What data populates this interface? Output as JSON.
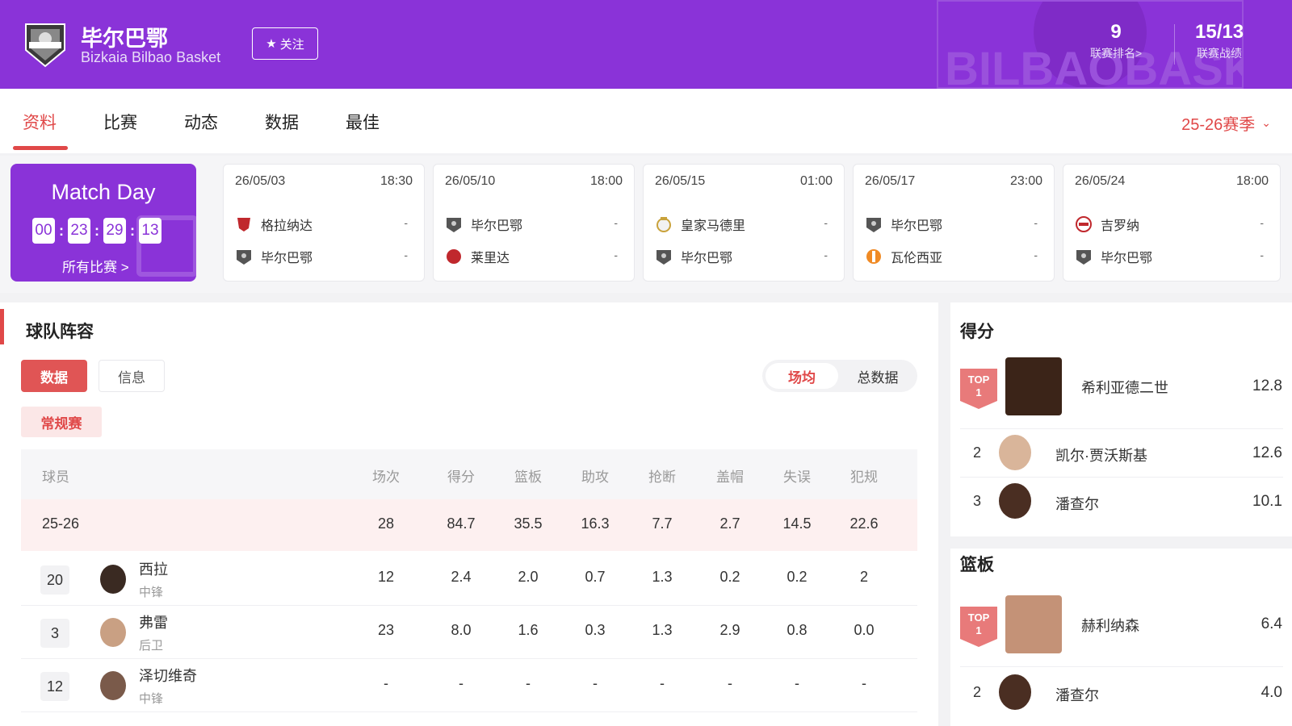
{
  "header": {
    "team_name": "毕尔巴鄂",
    "team_name_en": "Bizkaia Bilbao Basket",
    "follow_label": "关注",
    "league_rank_value": "9",
    "league_rank_label": "联赛排名>",
    "record_value": "15/13",
    "record_label": "联赛战绩",
    "brand_color": "#8a33d8"
  },
  "tabs": [
    {
      "label": "资料"
    },
    {
      "label": "比赛"
    },
    {
      "label": "动态"
    },
    {
      "label": "数据"
    },
    {
      "label": "最佳"
    }
  ],
  "season_selector": "25-26赛季",
  "matchday": {
    "title": "Match Day",
    "countdown": [
      "00",
      "23",
      "29",
      "13"
    ],
    "all_matches_label": "所有比赛 >"
  },
  "matches": [
    {
      "date": "26/05/03",
      "time": "18:30",
      "home": "格拉纳达",
      "home_score": "-",
      "away": "毕尔巴鄂",
      "away_score": "-"
    },
    {
      "date": "26/05/10",
      "time": "18:00",
      "home": "毕尔巴鄂",
      "home_score": "-",
      "away": "莱里达",
      "away_score": "-"
    },
    {
      "date": "26/05/15",
      "time": "01:00",
      "home": "皇家马德里",
      "home_score": "-",
      "away": "毕尔巴鄂",
      "away_score": "-"
    },
    {
      "date": "26/05/17",
      "time": "23:00",
      "home": "毕尔巴鄂",
      "home_score": "-",
      "away": "瓦伦西亚",
      "away_score": "-"
    },
    {
      "date": "26/05/24",
      "time": "18:00",
      "home": "吉罗纳",
      "home_score": "-",
      "away": "毕尔巴鄂",
      "away_score": "-"
    }
  ],
  "roster": {
    "title": "球队阵容",
    "btn_data": "数据",
    "btn_info": "信息",
    "toggle_avg": "场均",
    "toggle_total": "总数据",
    "regular_season": "常规赛",
    "columns": [
      "球员",
      "场次",
      "得分",
      "篮板",
      "助攻",
      "抢断",
      "盖帽",
      "失误",
      "犯规"
    ],
    "season_row": {
      "label": "25-26",
      "values": [
        "28",
        "84.7",
        "35.5",
        "16.3",
        "7.7",
        "2.7",
        "14.5",
        "22.6"
      ]
    },
    "players": [
      {
        "number": "20",
        "name": "西拉",
        "position": "中锋",
        "values": [
          "12",
          "2.4",
          "2.0",
          "0.7",
          "1.3",
          "0.2",
          "0.2",
          "2"
        ]
      },
      {
        "number": "3",
        "name": "弗雷",
        "position": "后卫",
        "values": [
          "23",
          "8.0",
          "1.6",
          "0.3",
          "1.3",
          "2.9",
          "0.8",
          "0.0"
        ]
      },
      {
        "number": "12",
        "name": "泽切维奇",
        "position": "中锋",
        "values": [
          "-",
          "-",
          "-",
          "-",
          "-",
          "-",
          "-",
          "-"
        ]
      }
    ]
  },
  "leaders": {
    "scoring": {
      "title": "得分",
      "top_badge": "TOP\n1",
      "entries": [
        {
          "rank": "1",
          "name": "希利亚德二世",
          "value": "12.8"
        },
        {
          "rank": "2",
          "name": "凯尔·贾沃斯基",
          "value": "12.6"
        },
        {
          "rank": "3",
          "name": "潘查尔",
          "value": "10.1"
        }
      ]
    },
    "rebounds": {
      "title": "篮板",
      "entries": [
        {
          "rank": "1",
          "name": "赫利纳森",
          "value": "6.4"
        },
        {
          "rank": "2",
          "name": "潘查尔",
          "value": "4.0"
        }
      ]
    }
  }
}
